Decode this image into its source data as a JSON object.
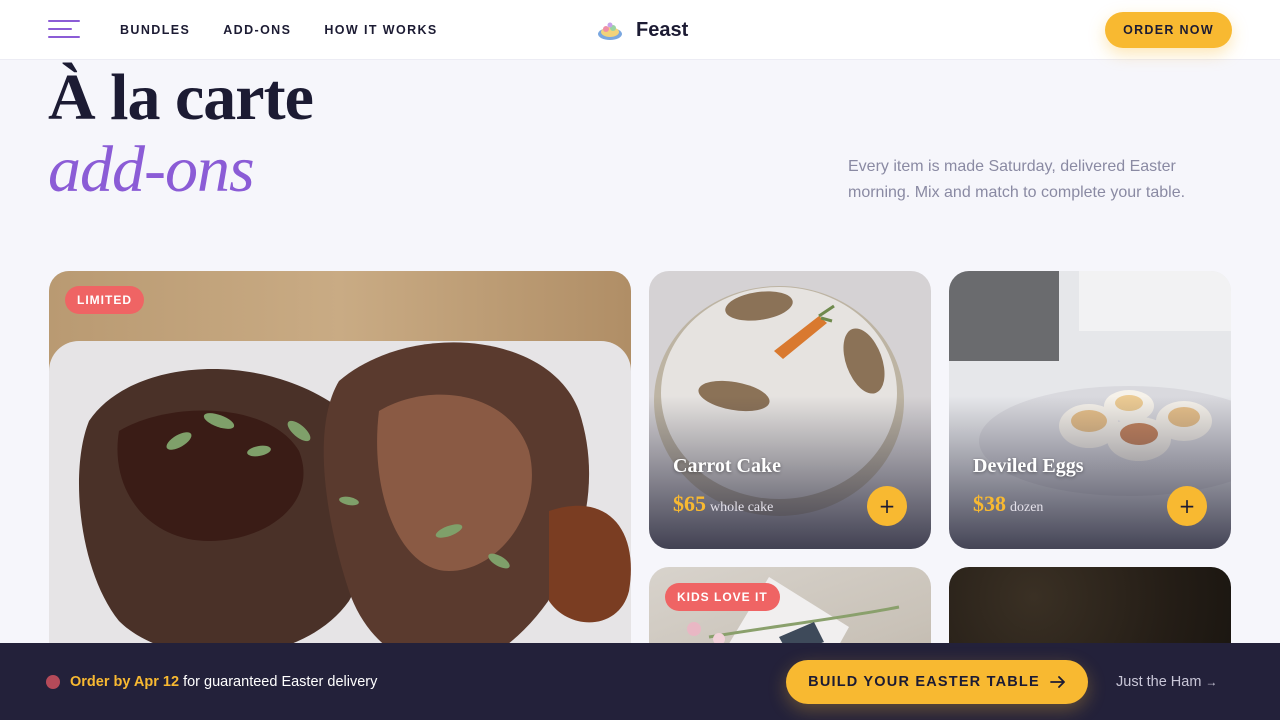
{
  "header": {
    "nav": [
      "BUNDLES",
      "ADD-ONS",
      "HOW IT WORKS"
    ],
    "brand": "Feast",
    "cta": "ORDER NOW"
  },
  "hero": {
    "title": "À la carte",
    "subtitle": "add-ons",
    "description": "Every item is made Saturday, delivered Easter morning. Mix and match to complete your table."
  },
  "cards": [
    {
      "badge": "LIMITED"
    },
    {
      "name": "Carrot Cake",
      "price": "$65",
      "unit": "whole cake",
      "add": "+"
    },
    {
      "name": "Deviled Eggs",
      "price": "$38",
      "unit": "dozen",
      "add": "+"
    },
    {
      "badge": "KIDS LOVE IT"
    }
  ],
  "bottom_bar": {
    "highlight": "Order by Apr 12",
    "note": " for guaranteed Easter delivery",
    "cta": "BUILD YOUR EASTER TABLE",
    "secondary": "Just the Ham",
    "secondary_arrow": "→"
  },
  "colors": {
    "accent_purple": "#8b5cd6",
    "accent_yellow": "#f8b931",
    "badge_red": "#ef6464",
    "dark_bar": "#23213a"
  },
  "icons": [
    "menu-icon",
    "brand-logo-icon",
    "plus-icon",
    "arrow-right-icon"
  ]
}
